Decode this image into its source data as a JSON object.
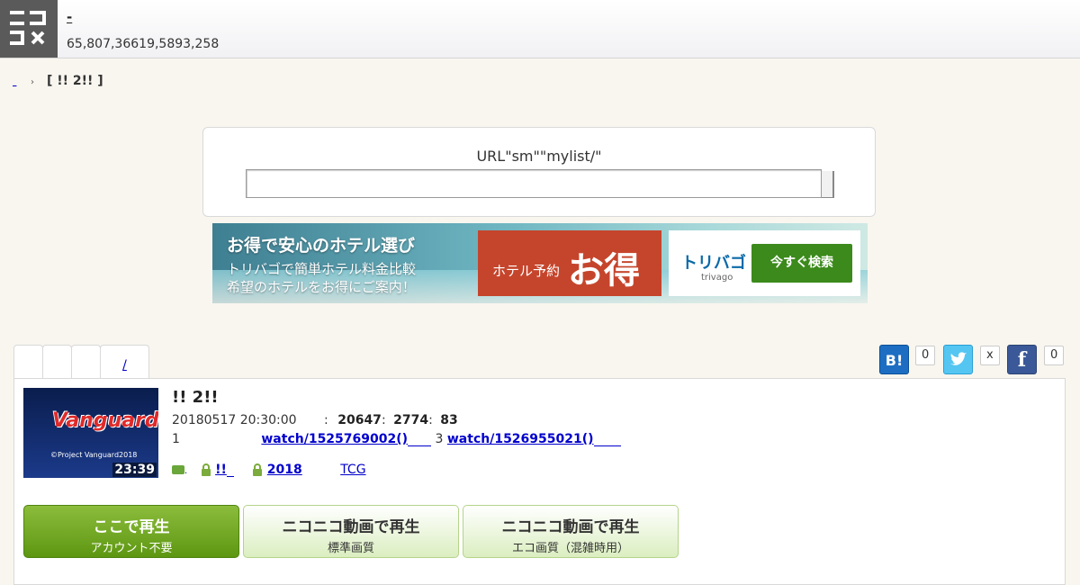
{
  "header": {
    "logo_alt": "niconico logo",
    "site_title": "-",
    "stats": "65,807,36619,5893,258"
  },
  "breadcrumb": {
    "home_link": "",
    "separator": "›",
    "current": "[ !! 2!! ]"
  },
  "search": {
    "label": "URL\"sm\"\"mylist/\"",
    "input_value": "",
    "input_placeholder": ""
  },
  "ad": {
    "headline": "お得で安心のホテル選び",
    "line1": "トリバゴで簡単ホテル料金比較",
    "line2": "希望のホテルをお得にご案内！",
    "red_small": "ホテル予約",
    "red_big": "お得",
    "brand": "トリバゴ",
    "brand_sub": "trivago",
    "cta": "今すぐ検索"
  },
  "tabs": {
    "link_label": "/"
  },
  "share": {
    "hatena_label": "B!",
    "hatena_count": "0",
    "twitter_count": "x",
    "facebook_label": "f",
    "facebook_count": "0"
  },
  "video": {
    "title": "!! 2!!",
    "duration": "23:39",
    "thumb_logo": "Vanguard",
    "thumb_copy": "©Project Vanguard2018",
    "date": "20180517 20:30:00",
    "views_prefix": ":",
    "views": "20647",
    "comments_prefix": ":",
    "comments": "2774",
    "mylist_prefix": ":",
    "mylist": "83",
    "part1_label": "1",
    "part1_link": "watch/1525769002()",
    "part3_label": "3",
    "part3_link": "watch/1526955021()",
    "tags": [
      {
        "text": "!!",
        "bold": true
      },
      {
        "text": "2018",
        "bold": true
      },
      {
        "text": "TCG",
        "bold": false
      },
      {
        "text": "",
        "bold": false
      }
    ]
  },
  "play_buttons": [
    {
      "big": "ここで再生",
      "small": "アカウント不要"
    },
    {
      "big": "ニコニコ動画で再生",
      "small": "標準画質"
    },
    {
      "big": "ニコニコ動画で再生",
      "small": "エコ画質（混雑時用）"
    }
  ],
  "colors": {
    "link": "#0000cc",
    "primary_green": "#5d9712",
    "twitter": "#1da1f2",
    "facebook": "#3b5998",
    "hatena": "#00a4de"
  }
}
